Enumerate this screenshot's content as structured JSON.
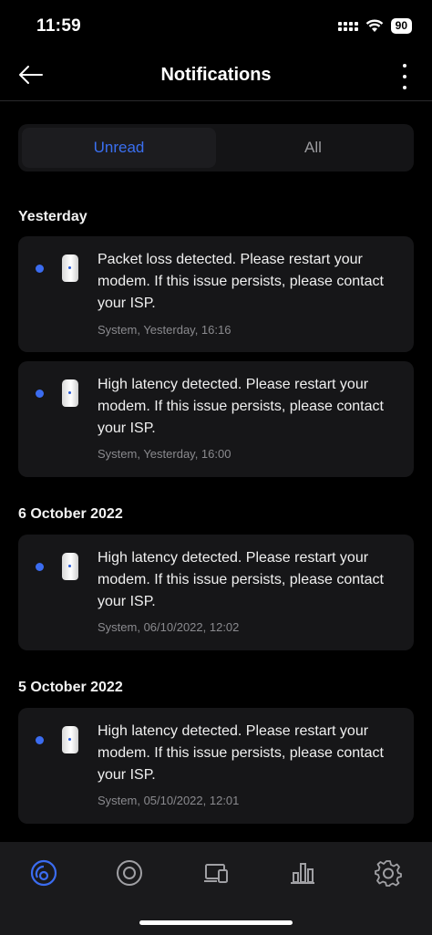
{
  "status_bar": {
    "time": "11:59",
    "battery": "90"
  },
  "header": {
    "title": "Notifications"
  },
  "tabs": [
    {
      "label": "Unread",
      "active": true
    },
    {
      "label": "All",
      "active": false
    }
  ],
  "sections": [
    {
      "title": "Yesterday",
      "items": [
        {
          "message": "Packet loss detected. Please restart your modem. If this issue persists, please contact your ISP.",
          "meta": "System, Yesterday, 16:16"
        },
        {
          "message": "High latency detected. Please restart your modem. If this issue persists, please contact your ISP.",
          "meta": "System, Yesterday, 16:00"
        }
      ]
    },
    {
      "title": "6 October 2022",
      "items": [
        {
          "message": "High latency detected. Please restart your modem. If this issue persists, please contact your ISP.",
          "meta": "System, 06/10/2022, 12:02"
        }
      ]
    },
    {
      "title": "5 October 2022",
      "items": [
        {
          "message": "High latency detected. Please restart your modem. If this issue persists, please contact your ISP.",
          "meta": "System, 05/10/2022, 12:01"
        }
      ]
    }
  ],
  "bottom_nav": [
    {
      "icon": "dashboard-icon",
      "active": true
    },
    {
      "icon": "target-icon",
      "active": false
    },
    {
      "icon": "devices-icon",
      "active": false
    },
    {
      "icon": "stats-icon",
      "active": false
    },
    {
      "icon": "gear-icon",
      "active": false
    }
  ],
  "colors": {
    "accent": "#3b6cf0",
    "unread_dot": "#3b6cf0",
    "background": "#000000",
    "card": "#161618"
  }
}
